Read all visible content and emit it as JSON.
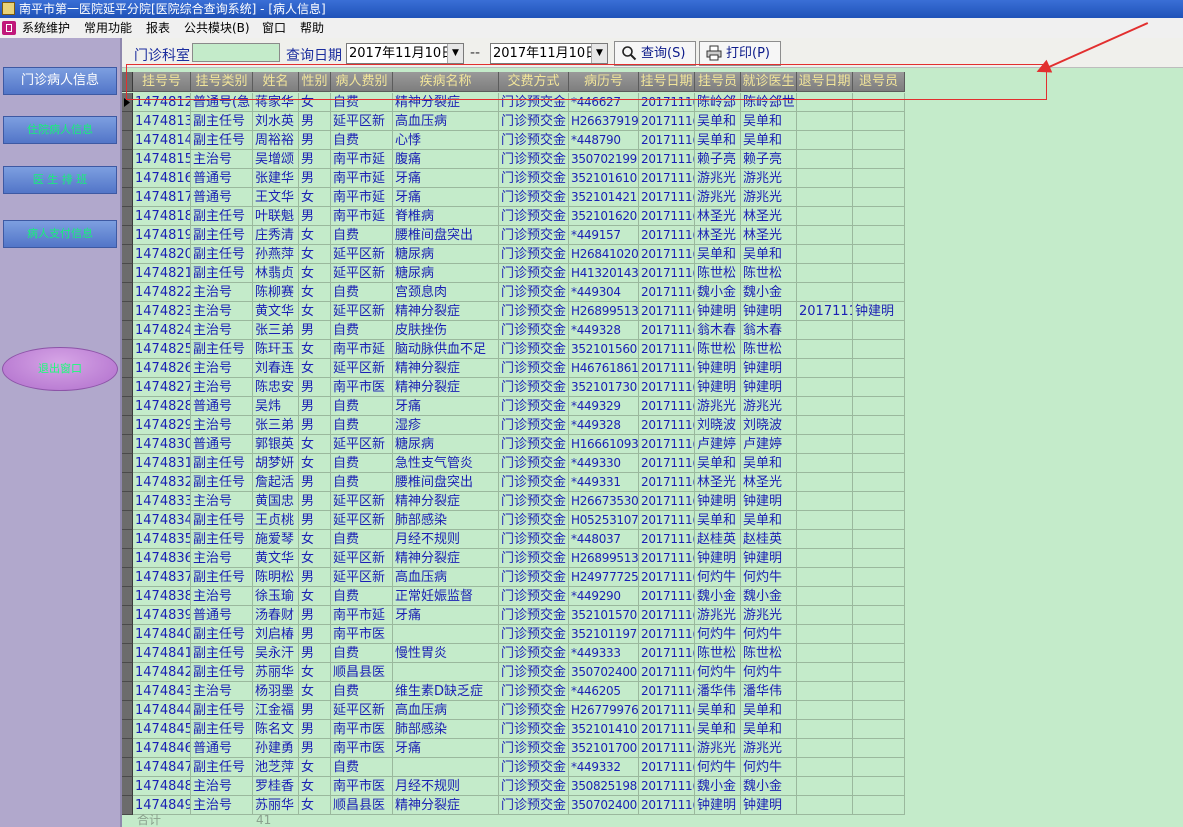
{
  "window": {
    "title": "南平市第一医院延平分院[医院综合查询系统] - [病人信息]"
  },
  "menu": [
    "系统维护",
    "常用功能",
    "报表",
    "公共模块(B)",
    "窗口",
    "帮助"
  ],
  "sidebar": {
    "items": [
      "门诊病人信息",
      "住院病人信息",
      "医 生 排 班",
      "病人支付信息"
    ],
    "exit_label": "退出窗口"
  },
  "toolbar": {
    "dept_label": "门诊科室",
    "dept_value": "",
    "date_label": "查询日期",
    "date_from": "2017年11月10日",
    "date_sep": "--",
    "date_to": "2017年11月10日",
    "query_label": "查询(S)",
    "print_label": "打印(P)"
  },
  "table": {
    "columns": [
      "挂号号",
      "挂号类别",
      "姓名",
      "性别",
      "病人费别",
      "疾病名称",
      "交费方式",
      "病历号",
      "挂号日期",
      "挂号员",
      "就诊医生",
      "退号日期",
      "退号员"
    ],
    "rows": [
      [
        "1474812",
        "普通号(急",
        "蒋家华",
        "女",
        "自费",
        "精神分裂症",
        "门诊预交金",
        "*446627",
        "2017111(",
        "陈岭郐",
        "陈岭郐世",
        "",
        ""
      ],
      [
        "1474813",
        "副主任号",
        "刘水英",
        "男",
        "延平区新",
        "高血压病",
        "门诊预交金",
        "H26637919",
        "2017111(",
        "吴单和",
        "吴单和",
        "",
        ""
      ],
      [
        "1474814",
        "副主任号",
        "周裕裕",
        "男",
        "自费",
        "心悸",
        "门诊预交金",
        "*448790",
        "2017111(",
        "吴单和",
        "吴单和",
        "",
        ""
      ],
      [
        "1474815",
        "主治号",
        "吴增颂",
        "男",
        "南平市延",
        "腹痛",
        "门诊预交金",
        "350702199",
        "2017111(",
        "赖子亮",
        "赖子亮",
        "",
        ""
      ],
      [
        "1474816",
        "普通号",
        "张建华",
        "男",
        "南平市延",
        "牙痛",
        "门诊预交金",
        "352101610",
        "2017111(",
        "游兆光",
        "游兆光",
        "",
        ""
      ],
      [
        "1474817",
        "普通号",
        "王文华",
        "女",
        "南平市延",
        "牙痛",
        "门诊预交金",
        "352101421",
        "2017111(",
        "游兆光",
        "游兆光",
        "",
        ""
      ],
      [
        "1474818",
        "副主任号",
        "叶联魁",
        "男",
        "南平市延",
        "脊椎病",
        "门诊预交金",
        "352101620",
        "2017111(",
        "林圣光",
        "林圣光",
        "",
        ""
      ],
      [
        "1474819",
        "副主任号",
        "庄秀清",
        "女",
        "自费",
        "腰椎间盘突出",
        "门诊预交金",
        "*449157",
        "2017111(",
        "林圣光",
        "林圣光",
        "",
        ""
      ],
      [
        "1474820",
        "副主任号",
        "孙燕萍",
        "女",
        "延平区新",
        "糖尿病",
        "门诊预交金",
        "H26841020",
        "2017111(",
        "吴单和",
        "吴单和",
        "",
        ""
      ],
      [
        "1474821",
        "副主任号",
        "林翡贞",
        "女",
        "延平区新",
        "糖尿病",
        "门诊预交金",
        "H41320143",
        "2017111(",
        "陈世松",
        "陈世松",
        "",
        ""
      ],
      [
        "1474822",
        "主治号",
        "陈柳赛",
        "女",
        "自费",
        "宫颈息肉",
        "门诊预交金",
        "*449304",
        "2017111(",
        "魏小金",
        "魏小金",
        "",
        ""
      ],
      [
        "1474823",
        "主治号",
        "黄文华",
        "女",
        "延平区新",
        "精神分裂症",
        "门诊预交金",
        "H26899513",
        "2017111(",
        "钟建明",
        "钟建明",
        "2017111(",
        "钟建明"
      ],
      [
        "1474824",
        "主治号",
        "张三弟",
        "男",
        "自费",
        "皮肤挫伤",
        "门诊预交金",
        "*449328",
        "2017111(",
        "翁木春",
        "翁木春",
        "",
        ""
      ],
      [
        "1474825",
        "副主任号",
        "陈玕玉",
        "女",
        "南平市延",
        "脑动脉供血不足",
        "门诊预交金",
        "352101560",
        "2017111(",
        "陈世松",
        "陈世松",
        "",
        ""
      ],
      [
        "1474826",
        "主治号",
        "刘春连",
        "女",
        "延平区新",
        "精神分裂症",
        "门诊预交金",
        "H46761861",
        "2017111(",
        "钟建明",
        "钟建明",
        "",
        ""
      ],
      [
        "1474827",
        "主治号",
        "陈忠安",
        "男",
        "南平市医",
        "精神分裂症",
        "门诊预交金",
        "352101730",
        "2017111(",
        "钟建明",
        "钟建明",
        "",
        ""
      ],
      [
        "1474828",
        "普通号",
        "吴炜",
        "男",
        "自费",
        "牙痛",
        "门诊预交金",
        "*449329",
        "2017111(",
        "游兆光",
        "游兆光",
        "",
        ""
      ],
      [
        "1474829",
        "主治号",
        "张三弟",
        "男",
        "自费",
        "湿疹",
        "门诊预交金",
        "*449328",
        "2017111(",
        "刘晓波",
        "刘晓波",
        "",
        ""
      ],
      [
        "1474830",
        "普通号",
        "郭银英",
        "女",
        "延平区新",
        "糖尿病",
        "门诊预交金",
        "H16661093",
        "2017111(",
        "卢建婷",
        "卢建婷",
        "",
        ""
      ],
      [
        "1474831",
        "副主任号",
        "胡梦妍",
        "女",
        "自费",
        "急性支气管炎",
        "门诊预交金",
        "*449330",
        "2017111(",
        "吴单和",
        "吴单和",
        "",
        ""
      ],
      [
        "1474832",
        "副主任号",
        "詹起活",
        "男",
        "自费",
        "腰椎间盘突出",
        "门诊预交金",
        "*449331",
        "2017111(",
        "林圣光",
        "林圣光",
        "",
        ""
      ],
      [
        "1474833",
        "主治号",
        "黄国忠",
        "男",
        "延平区新",
        "精神分裂症",
        "门诊预交金",
        "H26673530",
        "2017111(",
        "钟建明",
        "钟建明",
        "",
        ""
      ],
      [
        "1474834",
        "副主任号",
        "王贞桃",
        "男",
        "延平区新",
        "肺部感染",
        "门诊预交金",
        "H05253107",
        "2017111(",
        "吴单和",
        "吴单和",
        "",
        ""
      ],
      [
        "1474835",
        "副主任号",
        "施爱琴",
        "女",
        "自费",
        "月经不规则",
        "门诊预交金",
        "*448037",
        "2017111(",
        "赵桂英",
        "赵桂英",
        "",
        ""
      ],
      [
        "1474836",
        "主治号",
        "黄文华",
        "女",
        "延平区新",
        "精神分裂症",
        "门诊预交金",
        "H26899513",
        "2017111(",
        "钟建明",
        "钟建明",
        "",
        ""
      ],
      [
        "1474837",
        "副主任号",
        "陈明松",
        "男",
        "延平区新",
        "高血压病",
        "门诊预交金",
        "H24977725",
        "2017111(",
        "何灼牛",
        "何灼牛",
        "",
        ""
      ],
      [
        "1474838",
        "主治号",
        "徐玉瑜",
        "女",
        "自费",
        "正常妊娠监督",
        "门诊预交金",
        "*449290",
        "2017111(",
        "魏小金",
        "魏小金",
        "",
        ""
      ],
      [
        "1474839",
        "普通号",
        "汤春财",
        "男",
        "南平市延",
        "牙痛",
        "门诊预交金",
        "352101570",
        "2017111(",
        "游兆光",
        "游兆光",
        "",
        ""
      ],
      [
        "1474840",
        "副主任号",
        "刘启椿",
        "男",
        "南平市医",
        "",
        "门诊预交金",
        "352101197",
        "2017111(",
        "何灼牛",
        "何灼牛",
        "",
        ""
      ],
      [
        "1474841",
        "副主任号",
        "吴永汗",
        "男",
        "自费",
        "慢性胃炎",
        "门诊预交金",
        "*449333",
        "2017111(",
        "陈世松",
        "陈世松",
        "",
        ""
      ],
      [
        "1474842",
        "副主任号",
        "苏丽华",
        "女",
        "顺昌县医",
        "",
        "门诊预交金",
        "350702400",
        "2017111(",
        "何灼牛",
        "何灼牛",
        "",
        ""
      ],
      [
        "1474843",
        "主治号",
        "杨羽墨",
        "女",
        "自费",
        "维生素D缺乏症",
        "门诊预交金",
        "*446205",
        "2017111(",
        "潘华伟",
        "潘华伟",
        "",
        ""
      ],
      [
        "1474844",
        "副主任号",
        "江金福",
        "男",
        "延平区新",
        "高血压病",
        "门诊预交金",
        "H26779976",
        "2017111(",
        "吴单和",
        "吴单和",
        "",
        ""
      ],
      [
        "1474845",
        "副主任号",
        "陈名文",
        "男",
        "南平市医",
        "肺部感染",
        "门诊预交金",
        "352101410",
        "2017111(",
        "吴单和",
        "吴单和",
        "",
        ""
      ],
      [
        "1474846",
        "普通号",
        "孙建勇",
        "男",
        "南平市医",
        "牙痛",
        "门诊预交金",
        "352101700",
        "2017111(",
        "游兆光",
        "游兆光",
        "",
        ""
      ],
      [
        "1474847",
        "副主任号",
        "池芝萍",
        "女",
        "自费",
        "",
        "门诊预交金",
        "*449332",
        "2017111(",
        "何灼牛",
        "何灼牛",
        "",
        ""
      ],
      [
        "1474848",
        "主治号",
        "罗桂香",
        "女",
        "南平市医",
        "月经不规则",
        "门诊预交金",
        "350825198",
        "2017111(",
        "魏小金",
        "魏小金",
        "",
        ""
      ],
      [
        "1474849",
        "主治号",
        "苏丽华",
        "女",
        "顺昌县医",
        "精神分裂症",
        "门诊预交金",
        "350702400",
        "2017111(",
        "钟建明",
        "钟建明",
        "",
        ""
      ]
    ]
  },
  "footer": {
    "total_label": "合计",
    "count": "41"
  },
  "colors": {
    "grid_background": "#c4ebca",
    "cell_text": "#1a1fb4",
    "header_text": "#f2e59a",
    "sidebar_background": "#b1a8cc",
    "annotation": "#e22f2f"
  }
}
